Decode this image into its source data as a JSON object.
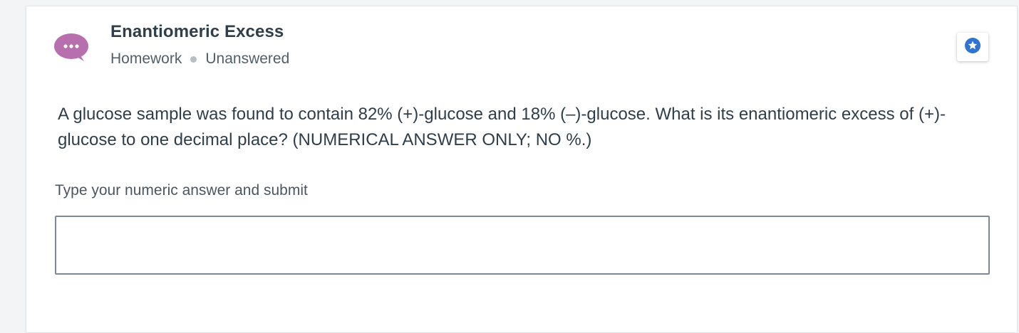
{
  "question_card": {
    "title": "Enantiomeric Excess",
    "category": "Homework",
    "status": "Unanswered",
    "avatar_icon": "chat-bubble-ellipsis-icon",
    "avatar_color": "#b86fae",
    "star_icon": "star-badge-icon",
    "star_color": "#2f74d0",
    "question_text": "A glucose sample was found to contain 82% (+)-glucose and 18% (–)-glucose. What is its enantiomeric excess of (+)-glucose to one decimal place? (NUMERICAL ANSWER ONLY; NO %.)",
    "answer_label": "Type your numeric answer and submit",
    "answer_value": "",
    "answer_placeholder": ""
  }
}
